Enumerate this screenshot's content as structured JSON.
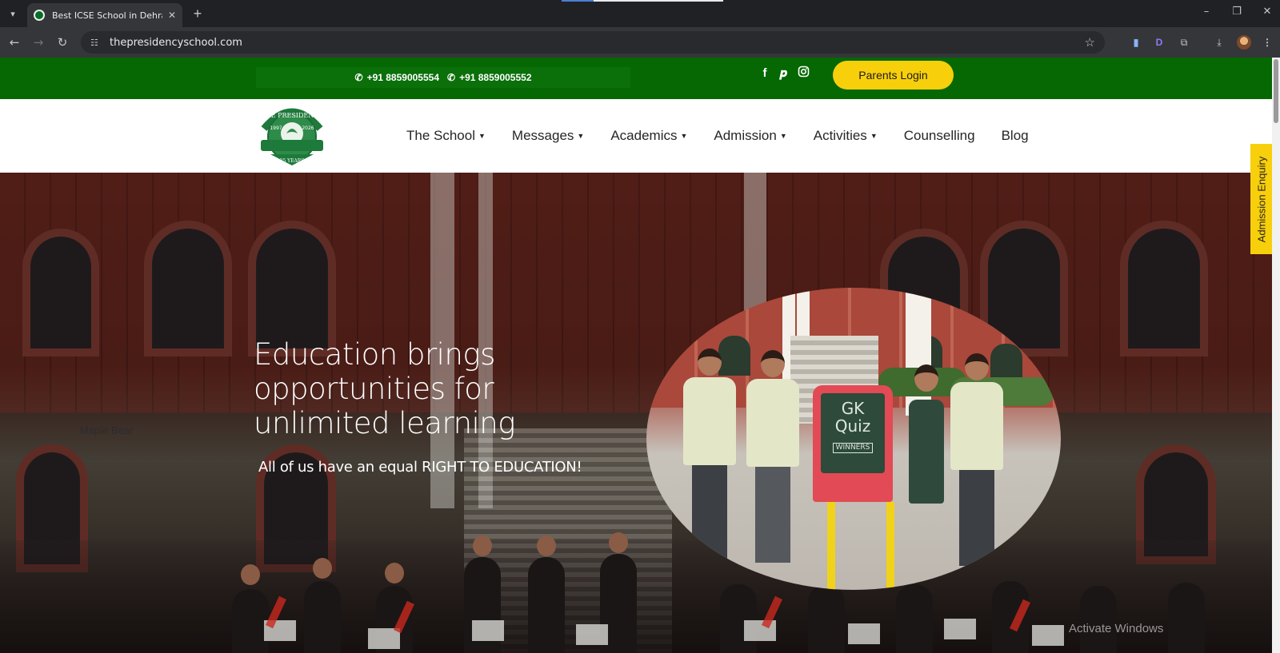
{
  "browser": {
    "tab_title": "Best ICSE School in Dehradun",
    "tab_close_icon": "close-icon",
    "new_tab_symbol": "+",
    "url": "thepresidencyschool.com",
    "window_controls": [
      "–",
      "❐",
      "✕"
    ]
  },
  "topbar": {
    "phones": [
      "+91 8859005554",
      "+91 8859005552"
    ],
    "social_icons": [
      "facebook-icon",
      "pinterest-icon",
      "instagram-icon"
    ],
    "parents_login": "Parents Login"
  },
  "navbar": {
    "logo_alt": "THE PRESIDENCY",
    "logo_years": "25 YEARS",
    "logo_start": "1997",
    "logo_end": "2026",
    "menu": [
      {
        "label": "The School",
        "dropdown": true
      },
      {
        "label": "Messages",
        "dropdown": true
      },
      {
        "label": "Academics",
        "dropdown": true
      },
      {
        "label": "Admission",
        "dropdown": true
      },
      {
        "label": "Activities",
        "dropdown": true
      },
      {
        "label": "Counselling",
        "dropdown": false
      },
      {
        "label": "Blog",
        "dropdown": false
      }
    ]
  },
  "hero": {
    "heading": "Education brings opportunities for unlimited learning",
    "subheading": "All of us have an equal RIGHT TO EDUCATION!",
    "board_text_1": "GK",
    "board_text_2": "Quiz",
    "board_text_3": "WINNERS",
    "background_sign": "Maple Bear"
  },
  "side_tab": {
    "label": "Admission Enquiry"
  },
  "overlay": {
    "activate_windows": "Activate Windows"
  },
  "colors": {
    "topbar_green": "#056803",
    "accent_yellow": "#f8cf0b"
  }
}
